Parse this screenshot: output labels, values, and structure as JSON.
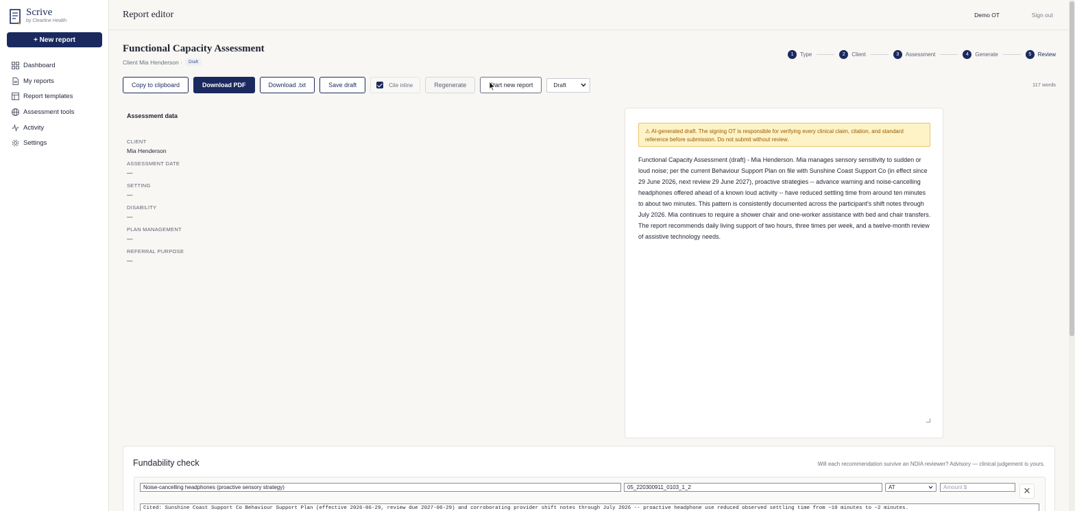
{
  "app": {
    "name": "Scrive",
    "tagline": "by Clearline Health",
    "new_report_label": "+ New report"
  },
  "nav": [
    {
      "label": "Dashboard",
      "icon": "grid-icon"
    },
    {
      "label": "My reports",
      "icon": "document-icon"
    },
    {
      "label": "Report templates",
      "icon": "template-icon"
    },
    {
      "label": "Assessment tools",
      "icon": "globe-icon"
    },
    {
      "label": "Activity",
      "icon": "activity-icon"
    },
    {
      "label": "Settings",
      "icon": "gear-icon"
    }
  ],
  "header": {
    "title": "Report editor",
    "user": "Demo OT",
    "signout": "Sign out"
  },
  "report": {
    "title": "Functional Capacity Assessment",
    "subtitle": "Client Mia Henderson ·",
    "status_badge": "Draft"
  },
  "steps": [
    {
      "num": "1",
      "label": "Type"
    },
    {
      "num": "2",
      "label": "Client"
    },
    {
      "num": "3",
      "label": "Assessment"
    },
    {
      "num": "4",
      "label": "Generate"
    },
    {
      "num": "5",
      "label": "Review"
    }
  ],
  "toolbar": {
    "copy": "Copy to clipboard",
    "download_pdf": "Download PDF",
    "download_txt": "Download .txt",
    "save_draft": "Save draft",
    "cite_inline": "Cite inline",
    "regenerate": "Regenerate",
    "start_new": "Start new report",
    "status_select": "Draft",
    "word_count": "117 words"
  },
  "assessment": {
    "title": "Assessment data",
    "fields": [
      {
        "label": "Client",
        "value": "Mia Henderson"
      },
      {
        "label": "Assessment date",
        "value": "—"
      },
      {
        "label": "Setting",
        "value": "—"
      },
      {
        "label": "Disability",
        "value": "—"
      },
      {
        "label": "Plan management",
        "value": "—"
      },
      {
        "label": "Referral purpose",
        "value": "—"
      }
    ]
  },
  "editor": {
    "warning": "⚠ AI-generated draft. The signing OT is responsible for verifying every clinical claim, citation, and standard reference before submission. Do not submit without review.",
    "body": "Functional Capacity Assessment (draft) - Mia Henderson. Mia manages sensory sensitivity to sudden or loud noise; per the current Behaviour Support Plan on file with Sunshine Coast Support Co (in effect since 29 June 2026, next review 29 June 2027), proactive strategies -- advance warning and noise-cancelling headphones offered ahead of a known loud activity -- have reduced settling time from around ten minutes to about two minutes. This pattern is consistently documented across the participant's shift notes through July 2026. Mia continues to require a shower chair and one-worker assistance with bed and chair transfers. The report recommends daily living support of two hours, three times per week, and a twelve-month review of assistive technology needs."
  },
  "fundability": {
    "title": "Fundability check",
    "hint": "Will each recommendation survive an NDIA reviewer? Advisory — clinical judgement is yours.",
    "item": "Noise-cancelling headphones (proactive sensory strategy)",
    "code": "05_220300911_0103_1_2",
    "category": "AT",
    "amount_placeholder": "Amount $",
    "cited": "Cited: Sunshine Coast Support Co Behaviour Support Plan (effective 2026-06-29, review due 2027-06-29) and corroborating provider shift notes through July 2026 -- proactive headphone use reduced observed settling time from ~10 minutes to ~2 minutes."
  },
  "colors": {
    "brand": "#1b2a5e",
    "warning_bg": "#fdf3c7",
    "warning_text": "#9a5a00"
  }
}
